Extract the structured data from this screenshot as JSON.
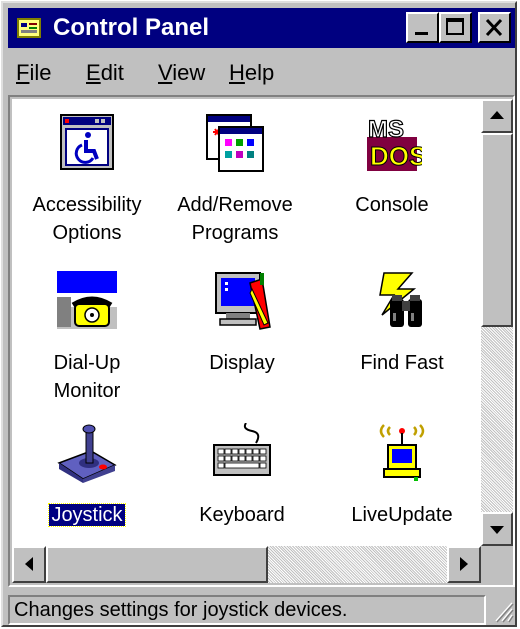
{
  "window": {
    "title": "Control Panel",
    "title_icon": "control-panel-icon",
    "controls": [
      "minimize-icon",
      "maximize-icon",
      "close-icon"
    ]
  },
  "menu": [
    {
      "label": "File"
    },
    {
      "label": "Edit"
    },
    {
      "label": "View"
    },
    {
      "label": "Help"
    }
  ],
  "items": [
    {
      "label": "Accessibility\nOptions",
      "icon": "accessibility-icon",
      "selected": false
    },
    {
      "label": "Add/Remove\nPrograms",
      "icon": "add-remove-programs-icon",
      "selected": false
    },
    {
      "label": "Console",
      "icon": "console-icon",
      "selected": false
    },
    {
      "label": "Dial-Up\nMonitor",
      "icon": "dial-up-monitor-icon",
      "selected": false
    },
    {
      "label": "Display",
      "icon": "display-icon",
      "selected": false
    },
    {
      "label": "Find Fast",
      "icon": "find-fast-icon",
      "selected": false
    },
    {
      "label": "Joystick",
      "icon": "joystick-icon",
      "selected": true
    },
    {
      "label": "Keyboard",
      "icon": "keyboard-icon",
      "selected": false
    },
    {
      "label": "LiveUpdate",
      "icon": "liveupdate-icon",
      "selected": false
    }
  ],
  "status": {
    "text": "Changes settings for joystick devices."
  },
  "colors": {
    "titlebar": "#000080",
    "face": "#c0c0c0",
    "selection": "#000080"
  }
}
